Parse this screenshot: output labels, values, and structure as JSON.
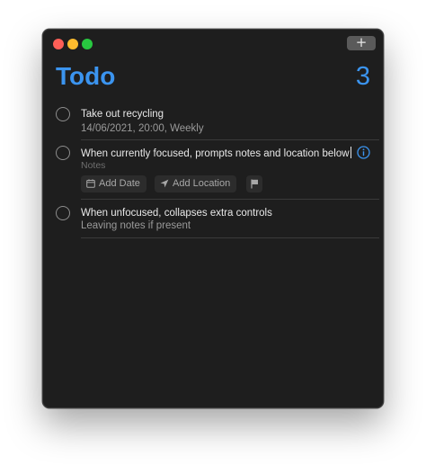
{
  "window": {
    "new_button_label": "+"
  },
  "header": {
    "title": "Todo",
    "count": "3"
  },
  "items": [
    {
      "title": "Take out recycling",
      "subtitle": "14/06/2021, 20:00, Weekly"
    },
    {
      "title": "When currently focused, prompts notes and location below",
      "notes_placeholder": "Notes",
      "controls": {
        "add_date": "Add Date",
        "add_location": "Add Location"
      }
    },
    {
      "title": "When unfocused, collapses extra controls",
      "subtitle": "Leaving notes if present"
    }
  ],
  "icons": {
    "info": "info-circle-icon",
    "calendar": "calendar-icon",
    "location": "location-arrow-icon",
    "flag": "flag-icon"
  },
  "colors": {
    "accent": "#3b94ef",
    "background": "#1e1e1e"
  }
}
